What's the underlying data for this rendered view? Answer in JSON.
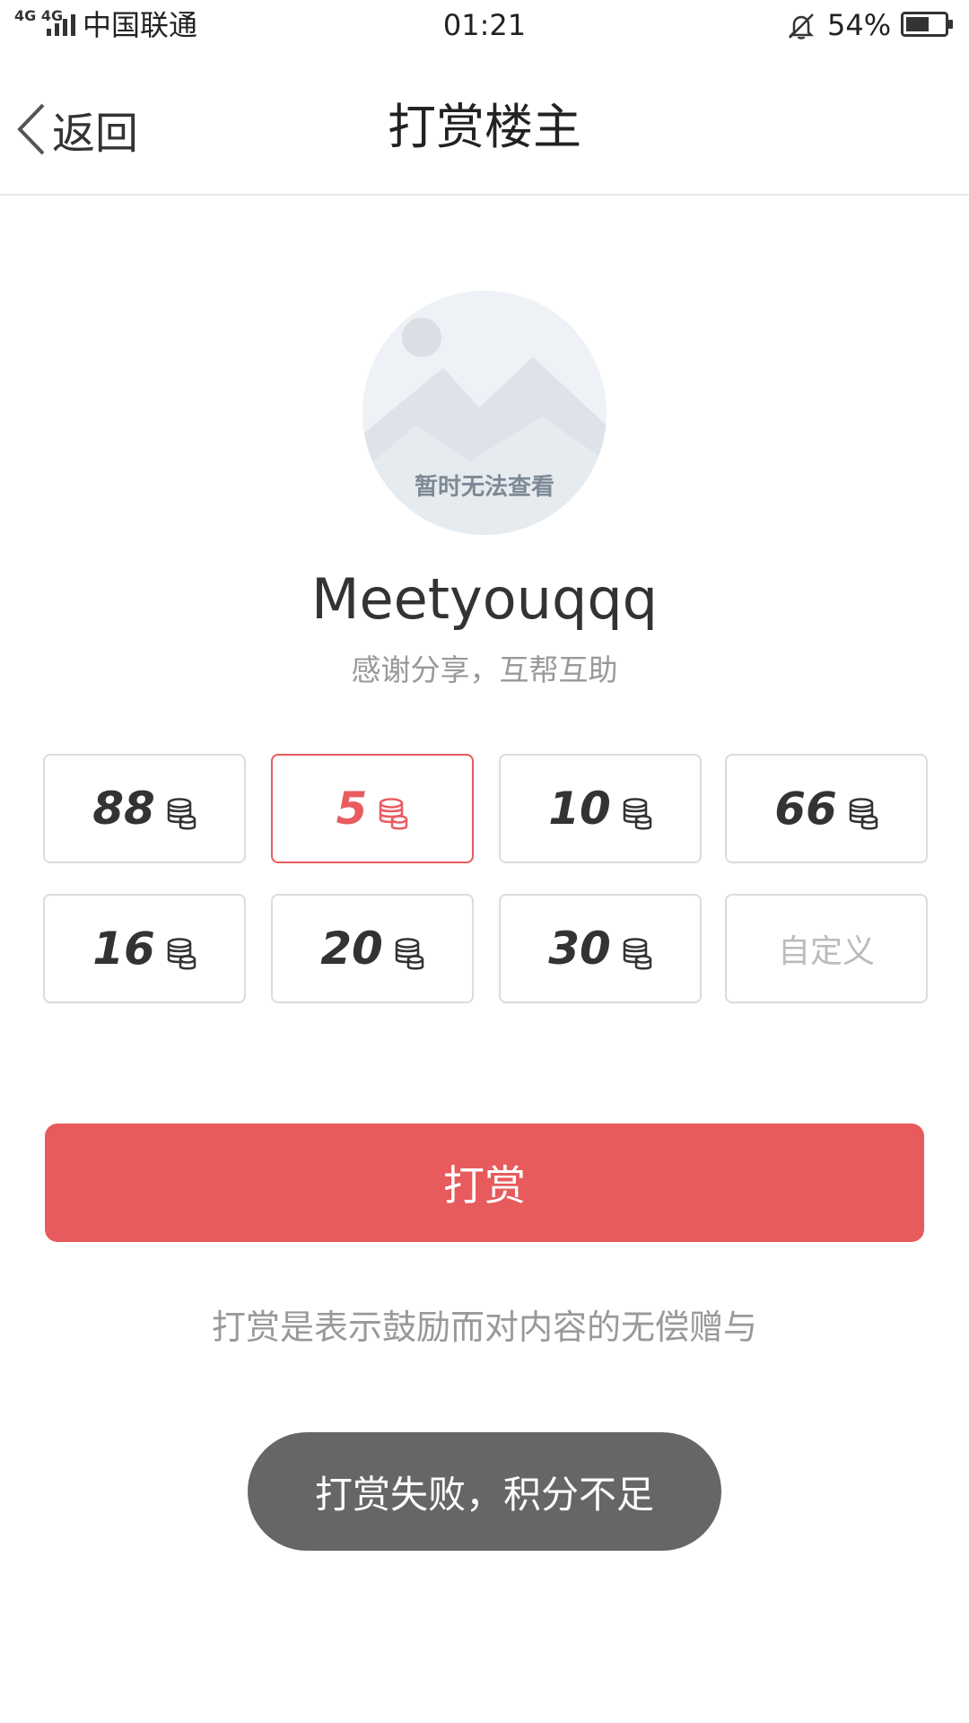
{
  "status_bar": {
    "network": "4G 4G",
    "carrier": "中国联通",
    "time": "01:21",
    "battery": "54%"
  },
  "nav": {
    "back_label": "返回",
    "title": "打赏楼主"
  },
  "avatar": {
    "caption": "暂时无法查看"
  },
  "user": {
    "name": "Meetyouqqq",
    "message": "感谢分享，互帮互助"
  },
  "amounts": [
    {
      "value": "88",
      "selected": false
    },
    {
      "value": "5",
      "selected": true
    },
    {
      "value": "10",
      "selected": false
    },
    {
      "value": "66",
      "selected": false
    },
    {
      "value": "16",
      "selected": false
    },
    {
      "value": "20",
      "selected": false
    },
    {
      "value": "30",
      "selected": false
    }
  ],
  "custom_label": "自定义",
  "reward_button": "打赏",
  "note": "打赏是表示鼓励而对内容的无偿赠与",
  "toast": "打赏失败，积分不足",
  "colors": {
    "accent": "#e75b5d",
    "toast_bg": "#666666",
    "border": "#dcdcdc"
  },
  "icons": [
    "signal-icon",
    "bell-off-icon",
    "battery-icon",
    "back-chevron-icon",
    "coin-stack-icon"
  ]
}
